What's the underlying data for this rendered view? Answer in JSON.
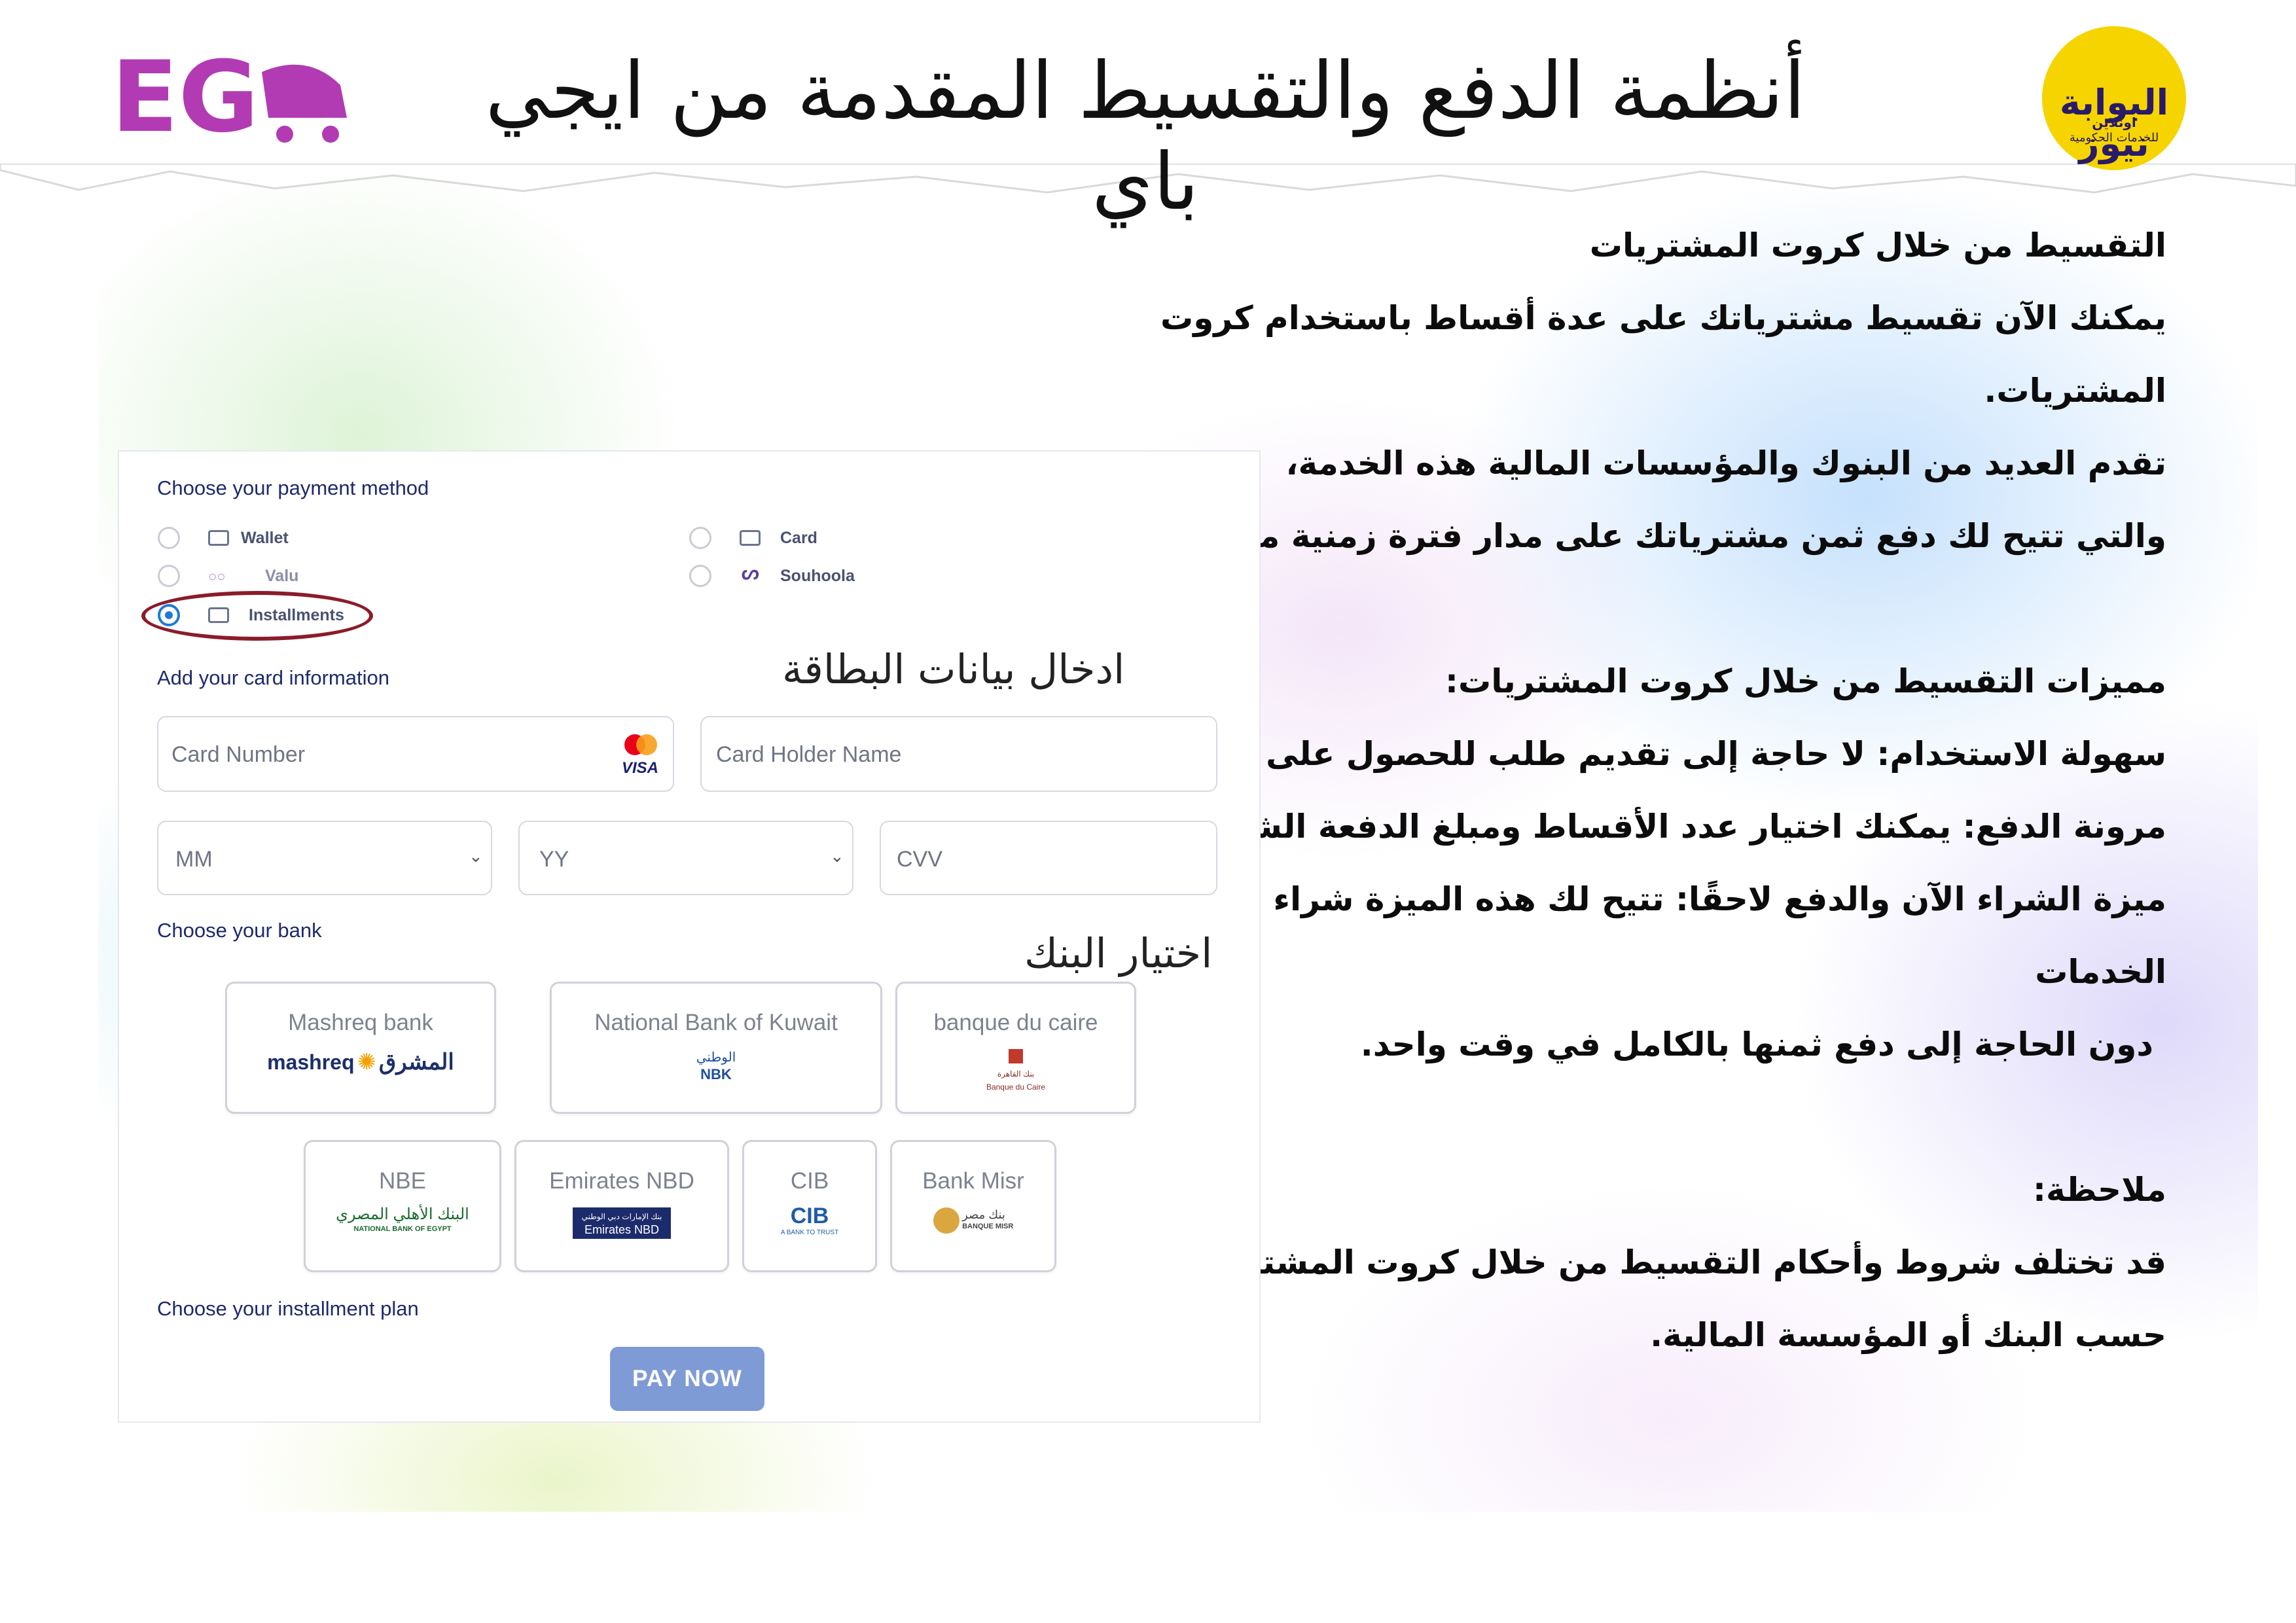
{
  "header": {
    "title": "أنظمة الدفع والتقسيط المقدمة من ايجي باي",
    "logo_left": "EG",
    "logo_right_text": "البوابة نيوز",
    "logo_right_sub": "اونلاين",
    "logo_right_caption": "للخدمات الحكومية"
  },
  "article": {
    "lines": [
      "التقسيط من خلال كروت المشتريات",
      "يمكنك الآن تقسيط مشترياتك على عدة أقساط باستخدام كروت",
      "المشتريات.",
      "تقدم العديد من البنوك والمؤسسات المالية هذه الخدمة،",
      "والتي تتيح لك دفع ثمن مشترياتك على مدار فترة زمنية محددة.",
      "",
      "مميزات التقسيط من خلال كروت المشتريات:",
      "سهولة الاستخدام: لا حاجة إلى تقديم طلب للحصول على قرض.",
      "مرونة الدفع: يمكنك اختيار عدد الأقساط ومبلغ الدفعة الشهرية.",
      "ميزة الشراء الآن والدفع لاحقًا: تتيح لك هذه الميزة شراء السلع أو",
      "الخدمات",
      "دون الحاجة إلى دفع ثمنها بالكامل في وقت واحد.",
      "",
      "ملاحظة:",
      "قد تختلف شروط وأحكام التقسيط من خلال كروت المشتريات",
      "حسب البنك أو المؤسسة المالية."
    ]
  },
  "payment": {
    "choose_method": "Choose your payment method",
    "methods": {
      "wallet": "Wallet",
      "card": "Card",
      "valu": "Valu",
      "souhoola": "Souhoola",
      "installments": "Installments"
    },
    "add_card_info": "Add your card information",
    "card_number_placeholder": "Card Number",
    "card_holder_placeholder": "Card Holder Name",
    "mm_placeholder": "MM",
    "yy_placeholder": "YY",
    "cvv_placeholder": "CVV",
    "visa_text": "VISA",
    "choose_bank": "Choose your bank",
    "banks": [
      {
        "name": "Mashreq bank",
        "logo_text": "mashreq",
        "logo_text_ar": "المشرق"
      },
      {
        "name": "National Bank of Kuwait",
        "logo_text": "NBK",
        "logo_text_ar": "الوطني"
      },
      {
        "name": "banque du caire",
        "logo_text": "Banque du Caire",
        "logo_text_ar": "بنك القاهرة"
      },
      {
        "name": "NBE",
        "logo_text": "NATIONAL BANK OF EGYPT",
        "logo_text_ar": "البنك الأهلي المصري"
      },
      {
        "name": "Emirates NBD",
        "logo_text": "Emirates NBD",
        "logo_text_ar": "بنك الإمارات دبي الوطني"
      },
      {
        "name": "CIB",
        "logo_text": "CIB",
        "logo_text_ar": "A BANK TO TRUST"
      },
      {
        "name": "Bank Misr",
        "logo_text": "BANQUE MISR",
        "logo_text_ar": "بنك مصر"
      }
    ],
    "choose_plan": "Choose your installment plan",
    "pay_now": "PAY NOW"
  },
  "notes": {
    "card_info_note": "ادخال بيانات البطاقة",
    "bank_note": "اختيار البنك"
  },
  "colors": {
    "accent": "#1f7ad6",
    "pay_button": "#7f9bd6",
    "highlight_ring": "#8b1c2a",
    "label_text": "#1e2a6b"
  },
  "selected_method": "installments"
}
